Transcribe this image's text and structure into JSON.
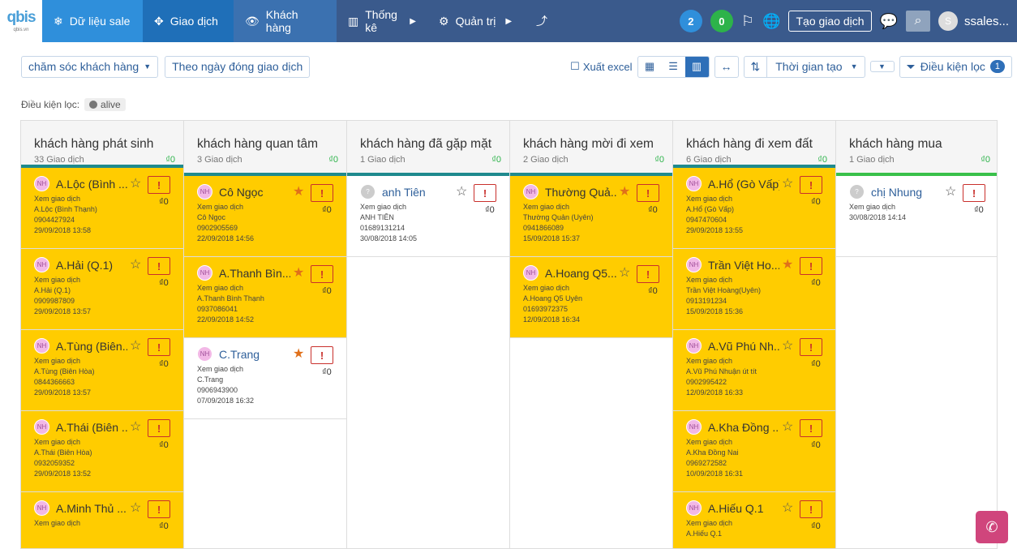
{
  "nav": {
    "logo_word": "qbis",
    "logo_sub": "qbis.vn",
    "items": [
      {
        "label": "Dữ liệu sale"
      },
      {
        "label": "Giao dịch"
      },
      {
        "label": "Khách hàng"
      },
      {
        "label": "Thống kê"
      },
      {
        "label": "Quản trị"
      }
    ],
    "badge_blue": "2",
    "badge_green": "0",
    "create_label": "Tạo giao dịch",
    "user_initial": "S",
    "user_name": "ssales..."
  },
  "toolbar": {
    "pipeline": "chăm sóc khách hàng",
    "date_filter": "Theo ngày đóng giao dịch",
    "export": "Xuất excel",
    "sort": "Thời gian tạo",
    "condition": "Điều kiện lọc",
    "condition_count": "1"
  },
  "filter": {
    "label": "Điều kiện lọc:",
    "tag": "alive"
  },
  "columns": [
    {
      "title": "khách hàng phát sinh",
      "count": "33 Giao dịch",
      "value": "₫0",
      "cards": [
        {
          "name": "A.Lộc (Bình ...",
          "activity": "Xem giao dịch",
          "contact": "A.Lộc (Bình Thạnh)",
          "phone": "0904427924",
          "date": "29/09/2018 13:58",
          "amount": "₫0",
          "starred": false
        },
        {
          "name": "A.Hải (Q.1)",
          "activity": "Xem giao dịch",
          "contact": "A.Hải (Q.1)",
          "phone": "0909987809",
          "date": "29/09/2018 13:57",
          "amount": "₫0",
          "starred": false
        },
        {
          "name": "A.Tùng (Biên...",
          "activity": "Xem giao dịch",
          "contact": "A.Tùng (Biên Hòa)",
          "phone": "0844366663",
          "date": "29/09/2018 13:57",
          "amount": "₫0",
          "starred": false
        },
        {
          "name": "A.Thái (Biên ...",
          "activity": "Xem giao dịch",
          "contact": "A.Thái (Biên Hòa)",
          "phone": "0932059352",
          "date": "29/09/2018 13:52",
          "amount": "₫0",
          "starred": false
        },
        {
          "name": "A.Minh Thủ ...",
          "activity": "Xem giao dịch",
          "contact": "",
          "phone": "",
          "date": "",
          "amount": "₫0",
          "starred": false
        }
      ]
    },
    {
      "title": "khách hàng quan tâm",
      "count": "3 Giao dịch",
      "value": "₫0",
      "cards": [
        {
          "name": "Cô Ngọc",
          "activity": "Xem giao dịch",
          "contact": "Cô Ngọc",
          "phone": "0902905569",
          "date": "22/09/2018 14:56",
          "amount": "₫0",
          "starred": true
        },
        {
          "name": "A.Thanh Bìn...",
          "activity": "Xem giao dịch",
          "contact": "A.Thanh Bình Thạnh",
          "phone": "0937086041",
          "date": "22/09/2018 14:52",
          "amount": "₫0",
          "starred": true
        },
        {
          "name": "C.Trang",
          "activity": "Xem giao dịch",
          "contact": "C.Trang",
          "phone": "0906943900",
          "date": "07/09/2018 16:32",
          "amount": "₫0",
          "starred": true,
          "white": true
        }
      ]
    },
    {
      "title": "khách hàng đã gặp mặt",
      "count": "1 Giao dịch",
      "value": "₫0",
      "cards": [
        {
          "name": "anh Tiên",
          "activity": "Xem giao dịch",
          "contact": "ANH TIÊN",
          "phone": "01689131214",
          "date": "30/08/2018 14:05",
          "amount": "₫0",
          "starred": false,
          "white": true
        }
      ]
    },
    {
      "title": "khách hàng mời đi xem",
      "count": "2 Giao dịch",
      "value": "₫0",
      "cards": [
        {
          "name": "Thường Quả...",
          "activity": "Xem giao dịch",
          "contact": "Thường Quản (Uyên)",
          "phone": "0941866089",
          "date": "15/09/2018 15:37",
          "amount": "₫0",
          "starred": true
        },
        {
          "name": "A.Hoang Q5...",
          "activity": "Xem giao dịch",
          "contact": "A.Hoang Q5 Uyên",
          "phone": "01693972375",
          "date": "12/09/2018 16:34",
          "amount": "₫0",
          "starred": false
        }
      ]
    },
    {
      "title": "khách hàng đi xem đất",
      "count": "6 Giao dịch",
      "value": "₫0",
      "cards": [
        {
          "name": "A.Hổ (Gò Vấp)",
          "activity": "Xem giao dịch",
          "contact": "A.Hổ (Gò Vấp)",
          "phone": "0947470604",
          "date": "29/09/2018 13:55",
          "amount": "₫0",
          "starred": false
        },
        {
          "name": "Trần Việt Ho...",
          "activity": "Xem giao dịch",
          "contact": "Trần Việt Hoàng(Uyên)",
          "phone": "0913191234",
          "date": "15/09/2018 15:36",
          "amount": "₫0",
          "starred": true
        },
        {
          "name": "A.Vũ Phú Nh...",
          "activity": "Xem giao dịch",
          "contact": "A.Vũ Phú Nhuận út tít",
          "phone": "0902995422",
          "date": "12/09/2018 16:33",
          "amount": "₫0",
          "starred": false
        },
        {
          "name": "A.Kha Đồng ...",
          "activity": "Xem giao dịch",
          "contact": "A.Kha Đồng Nai",
          "phone": "0969272582",
          "date": "10/09/2018 16:31",
          "amount": "₫0",
          "starred": false
        },
        {
          "name": "A.Hiếu Q.1",
          "activity": "Xem giao dịch",
          "contact": "A.Hiếu Q.1",
          "phone": "",
          "date": "",
          "amount": "₫0",
          "starred": false
        }
      ]
    },
    {
      "title": "khách hàng mua",
      "count": "1 Giao dịch",
      "value": "₫0",
      "cards": [
        {
          "name": "chị Nhung",
          "activity": "Xem giao dịch",
          "contact": "30/08/2018 14:14",
          "phone": "",
          "date": "",
          "amount": "₫0",
          "starred": false,
          "white": true
        }
      ]
    }
  ]
}
